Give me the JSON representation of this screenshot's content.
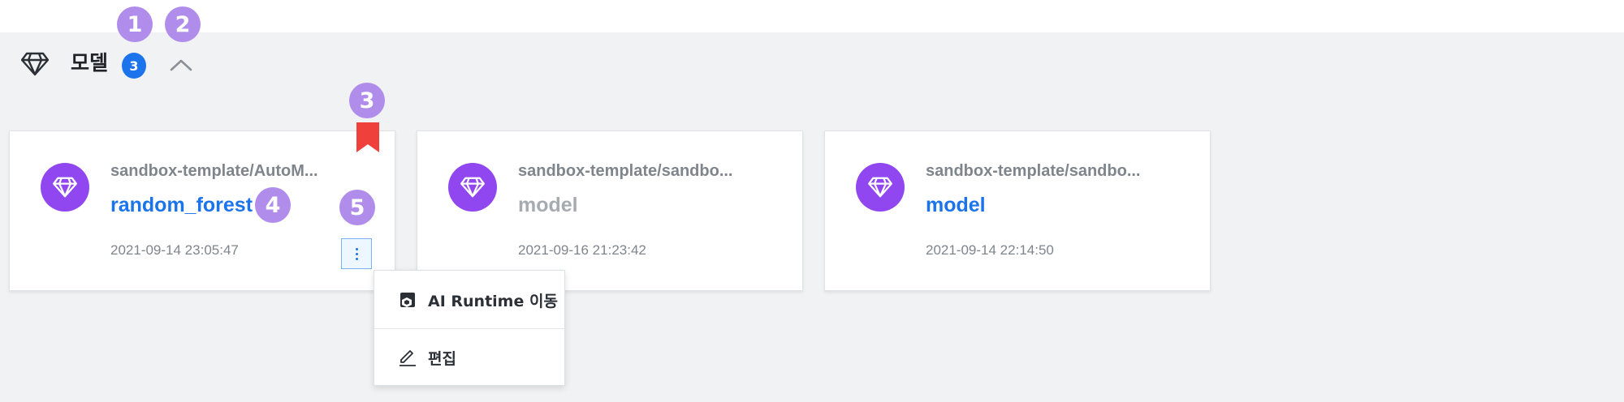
{
  "section": {
    "title": "모델",
    "count": "3",
    "icon": "diamond-icon",
    "collapse_icon": "chevron-up-icon"
  },
  "callouts": [
    "1",
    "2",
    "3",
    "4",
    "5"
  ],
  "cards": [
    {
      "path": "sandbox-template/AutoM...",
      "name": "random_forest",
      "date": "2021-09-14 23:05:47",
      "status": "active",
      "bookmarked": true,
      "icon": "diamond-icon"
    },
    {
      "path": "sandbox-template/sandbo...",
      "name": "model",
      "date": "2021-09-16 21:23:42",
      "status": "inactive",
      "icon": "diamond-icon"
    },
    {
      "path": "sandbox-template/sandbo...",
      "name": "model",
      "date": "2021-09-14 22:14:50",
      "status": "active",
      "icon": "diamond-icon"
    }
  ],
  "menu": {
    "items": [
      {
        "label": "AI Runtime 이동",
        "icon": "runtime-icon"
      },
      {
        "label": "편집",
        "icon": "pencil-icon"
      }
    ]
  },
  "colors": {
    "accent": "#1b74ec",
    "avatar": "#9147f0",
    "bookmark": "#f0403c",
    "callout": "#b08ceb"
  }
}
